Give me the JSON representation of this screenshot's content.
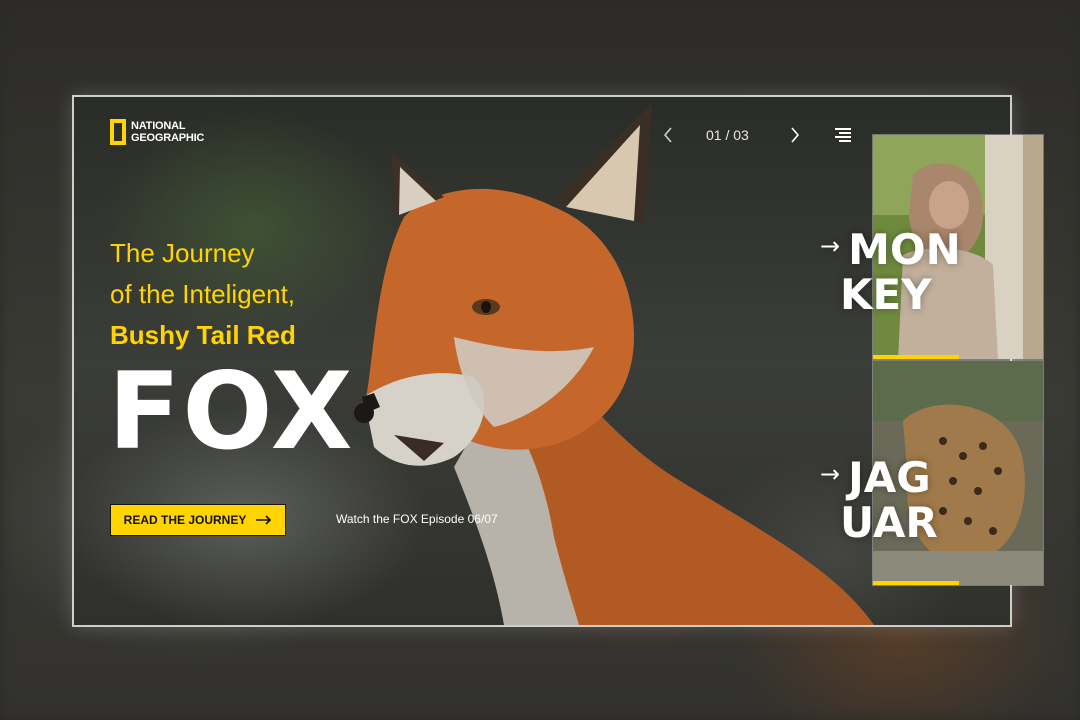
{
  "brand": {
    "line1": "NATIONAL",
    "line2": "GEOGRAPHIC",
    "accent": "#ffd400"
  },
  "pager": {
    "current": "01 / 03",
    "prev_icon": "chevron-left-icon",
    "next_icon": "chevron-right-icon",
    "menu_icon": "menu-icon"
  },
  "hero": {
    "line1": "The Journey",
    "line2": "of the Inteligent,",
    "line3": "Bushy Tail Red",
    "title": "FOX",
    "cta_label": "READ THE JOURNEY",
    "episode": "Watch the FOX Episode 06/07"
  },
  "side": {
    "items": [
      {
        "line1": "MON",
        "line2": "KEY"
      },
      {
        "line1": "JAG",
        "line2": "UAR"
      }
    ]
  },
  "colors": {
    "accent": "#ffd400",
    "fox_orange": "#c0612a"
  }
}
